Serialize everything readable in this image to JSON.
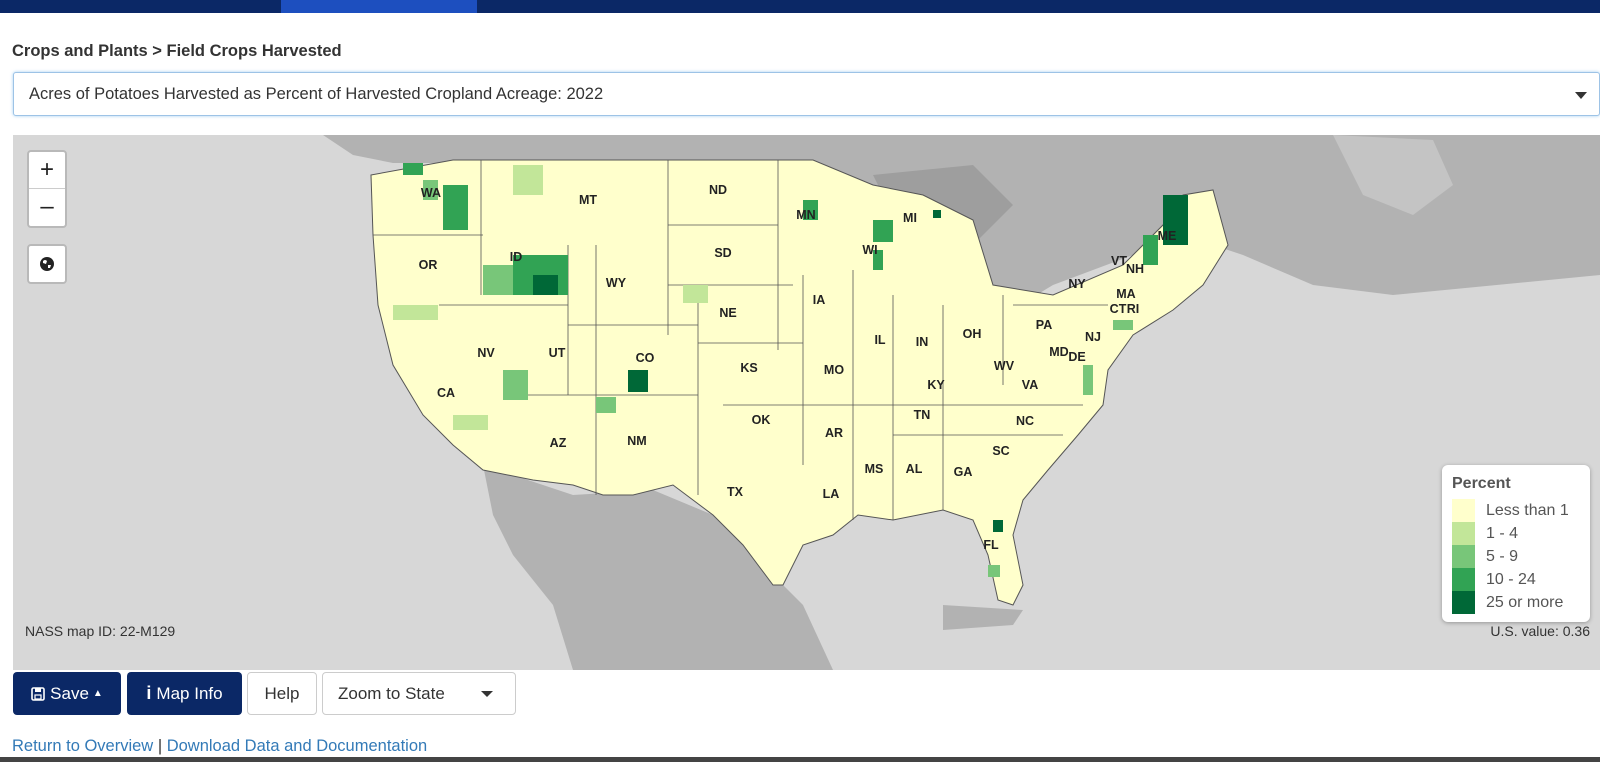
{
  "breadcrumb": "Crops and Plants > Field Crops Harvested",
  "map_selector": {
    "selected": "Acres of Potatoes Harvested as Percent of Harvested Cropland Acreage: 2022"
  },
  "zoom": {
    "in_label": "+",
    "out_label": "–"
  },
  "globe_icon": "globe-icon",
  "state_labels": [
    "WA",
    "MT",
    "ND",
    "MN",
    "WI",
    "MI",
    "OR",
    "ID",
    "SD",
    "WY",
    "IA",
    "NE",
    "NV",
    "UT",
    "CO",
    "KS",
    "MO",
    "IL",
    "IN",
    "OH",
    "PA",
    "NY",
    "VT",
    "NH",
    "ME",
    "MA",
    "CT",
    "RI",
    "NJ",
    "MD",
    "DE",
    "WV",
    "VA",
    "KY",
    "TN",
    "NC",
    "SC",
    "GA",
    "AL",
    "MS",
    "AR",
    "LA",
    "OK",
    "TX",
    "NM",
    "AZ",
    "CA",
    "FL"
  ],
  "legend": {
    "title": "Percent",
    "items": [
      {
        "label": "Less than 1",
        "color": "#ffffcc"
      },
      {
        "label": "1 - 4",
        "color": "#c2e699"
      },
      {
        "label": "5 - 9",
        "color": "#78c679"
      },
      {
        "label": "10 - 24",
        "color": "#31a354"
      },
      {
        "label": "25 or more",
        "color": "#006837"
      }
    ]
  },
  "map_id": "NASS map ID: 22-M129",
  "us_value": "U.S. value: 0.36",
  "buttons": {
    "save": "Save",
    "map_info": "Map Info",
    "help": "Help",
    "zoom_to_state": "Zoom to State"
  },
  "links": {
    "overview": "Return to Overview",
    "separator": "|",
    "download": "Download Data and Documentation"
  },
  "colors": {
    "navy": "#0b2866",
    "ocean": "#d7d7d7",
    "land_outside": "#b2b2b2",
    "link": "#337ab7"
  }
}
